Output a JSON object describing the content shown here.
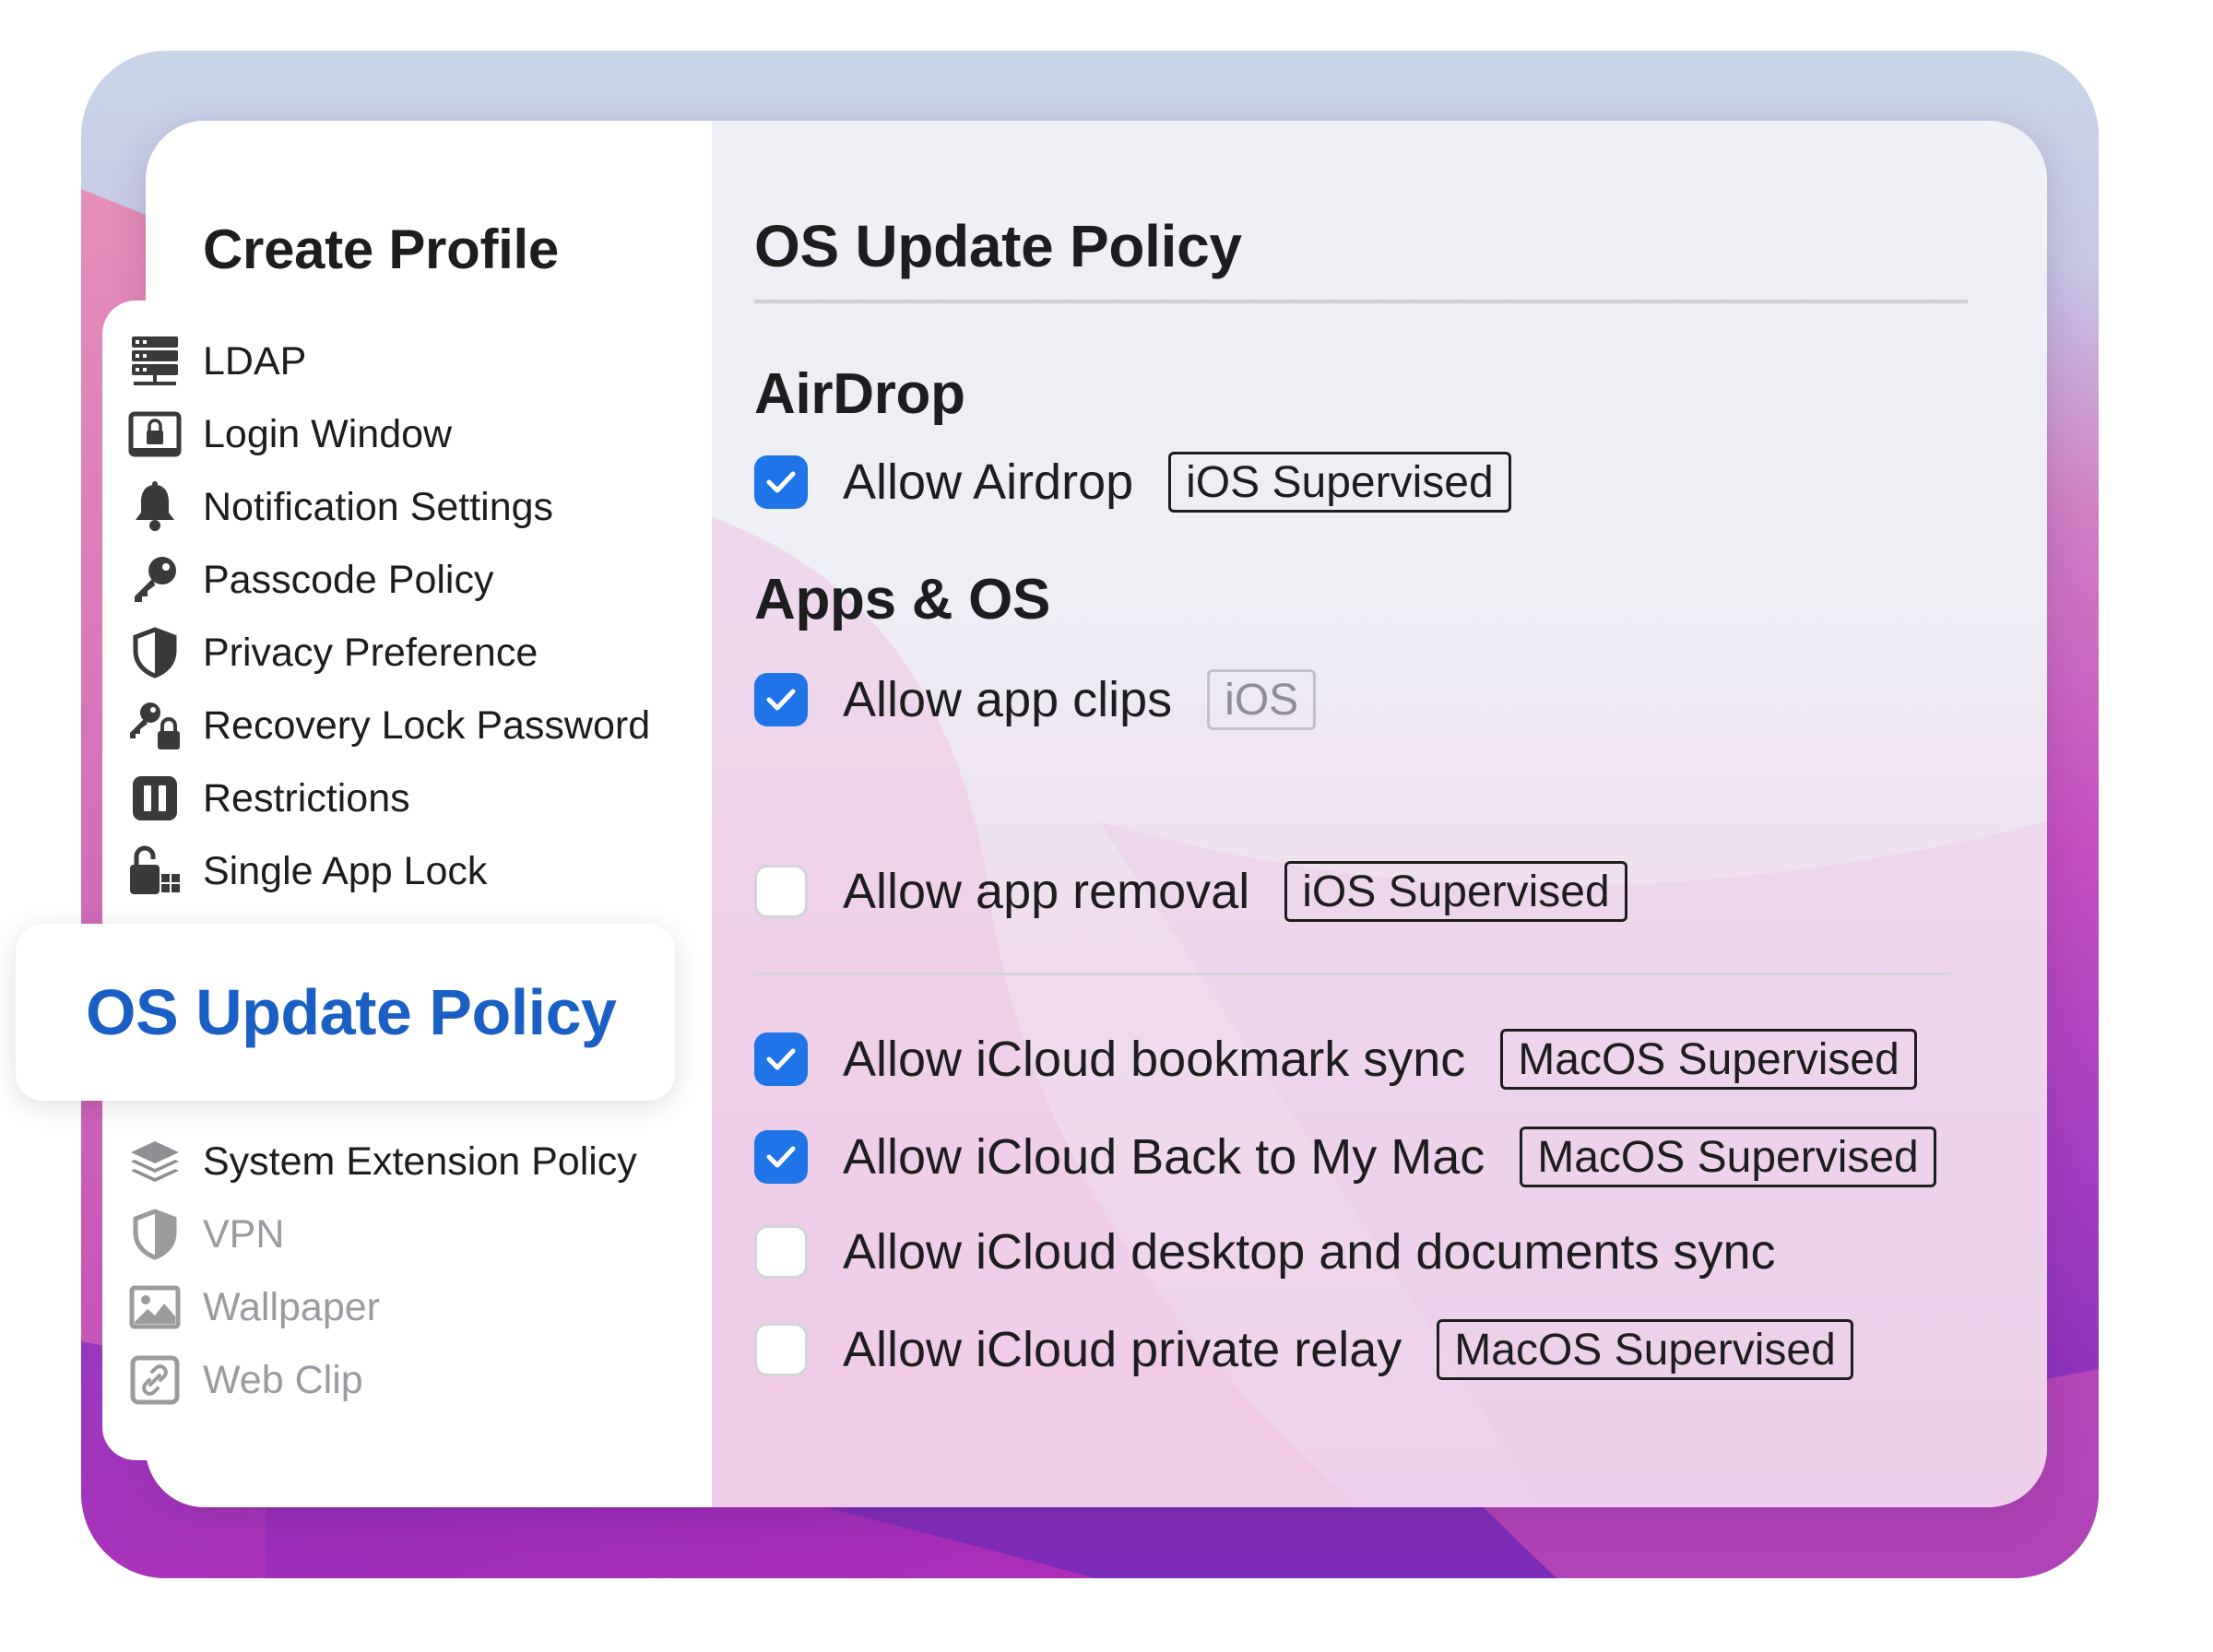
{
  "sidebar": {
    "title": "Create Profile",
    "items": [
      {
        "label": "LDAP",
        "icon": "server-icon"
      },
      {
        "label": "Login Window",
        "icon": "login-window-icon"
      },
      {
        "label": "Notification Settings",
        "icon": "bell-icon"
      },
      {
        "label": "Passcode Policy",
        "icon": "key-icon"
      },
      {
        "label": "Privacy Preference",
        "icon": "shield-icon"
      },
      {
        "label": "Recovery Lock Password",
        "icon": "key-lock-icon"
      },
      {
        "label": "Restrictions",
        "icon": "restrictions-icon"
      },
      {
        "label": "Single App Lock",
        "icon": "app-lock-icon"
      }
    ],
    "selected": {
      "label": "OS Update Policy"
    },
    "items_after": [
      {
        "label": "System Extension Policy",
        "icon": "layers-icon"
      },
      {
        "label": "VPN",
        "icon": "shield-icon"
      },
      {
        "label": "Wallpaper",
        "icon": "image-icon"
      },
      {
        "label": "Web Clip",
        "icon": "link-icon"
      }
    ]
  },
  "main": {
    "title": "OS Update Policy",
    "sections": [
      {
        "heading": "AirDrop",
        "rows": [
          {
            "label": "Allow Airdrop",
            "checked": true,
            "badge": "iOS Supervised"
          }
        ]
      },
      {
        "heading": "Apps & OS",
        "rows": [
          {
            "label": "Allow app clips",
            "checked": true,
            "badge": "iOS"
          },
          {
            "label": "Allow app removal",
            "checked": false,
            "badge": "iOS Supervised"
          }
        ]
      },
      {
        "heading": "",
        "rows": [
          {
            "label": "Allow iCloud bookmark sync",
            "checked": true,
            "badge": "MacOS Supervised"
          },
          {
            "label": "Allow iCloud Back to My Mac",
            "checked": true,
            "badge": "MacOS Supervised"
          },
          {
            "label": "Allow iCloud desktop and documents sync",
            "checked": false,
            "badge": ""
          },
          {
            "label": "Allow iCloud private relay",
            "checked": false,
            "badge": "MacOS Supervised"
          }
        ]
      }
    ]
  },
  "colors": {
    "accent": "#1f74e8",
    "selected_text": "#1a5fc4"
  }
}
